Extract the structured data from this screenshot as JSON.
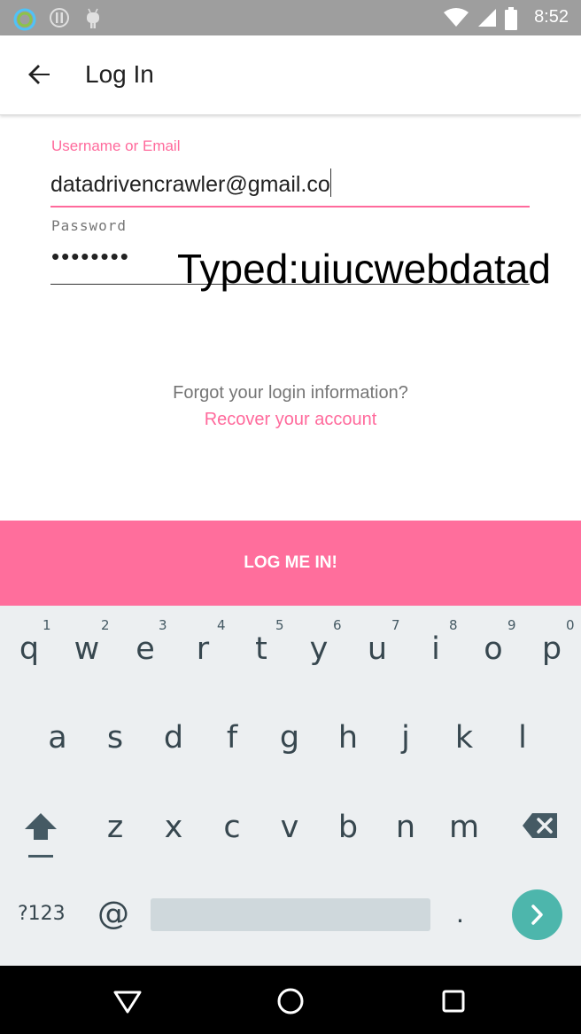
{
  "status_bar": {
    "time": "8:52",
    "left_icons": [
      "app-ring-icon",
      "alert-icon",
      "android-icon"
    ],
    "right_icons": [
      "wifi-icon",
      "signal-icon",
      "battery-icon"
    ]
  },
  "app_bar": {
    "title": "Log In",
    "back_icon": "arrow-back-icon"
  },
  "form": {
    "username_label": "Username or Email",
    "username_value": "datadrivencrawler@gmail.co",
    "password_label": "Password",
    "password_masked": "••••••••",
    "typed_overlay": "Typed:uiucwebdatad"
  },
  "links": {
    "forgot_text": "Forgot your login information?",
    "recover_text": "Recover your account"
  },
  "login_button": {
    "label": "LOG ME IN!"
  },
  "keyboard": {
    "row1": [
      {
        "key": "q",
        "hint": "1"
      },
      {
        "key": "w",
        "hint": "2"
      },
      {
        "key": "e",
        "hint": "3"
      },
      {
        "key": "r",
        "hint": "4"
      },
      {
        "key": "t",
        "hint": "5"
      },
      {
        "key": "y",
        "hint": "6"
      },
      {
        "key": "u",
        "hint": "7"
      },
      {
        "key": "i",
        "hint": "8"
      },
      {
        "key": "o",
        "hint": "9"
      },
      {
        "key": "p",
        "hint": "0"
      }
    ],
    "row2": [
      "a",
      "s",
      "d",
      "f",
      "g",
      "h",
      "j",
      "k",
      "l"
    ],
    "row3": [
      "z",
      "x",
      "c",
      "v",
      "b",
      "n",
      "m"
    ],
    "symbols_label": "?123",
    "at_label": "@",
    "dot_label": "."
  },
  "colors": {
    "accent": "#ff6a9c",
    "button": "#ff6e9c",
    "keyboard_bg": "#eceff1",
    "go_key": "#4db6ac",
    "status_bar": "#9e9e9e"
  }
}
